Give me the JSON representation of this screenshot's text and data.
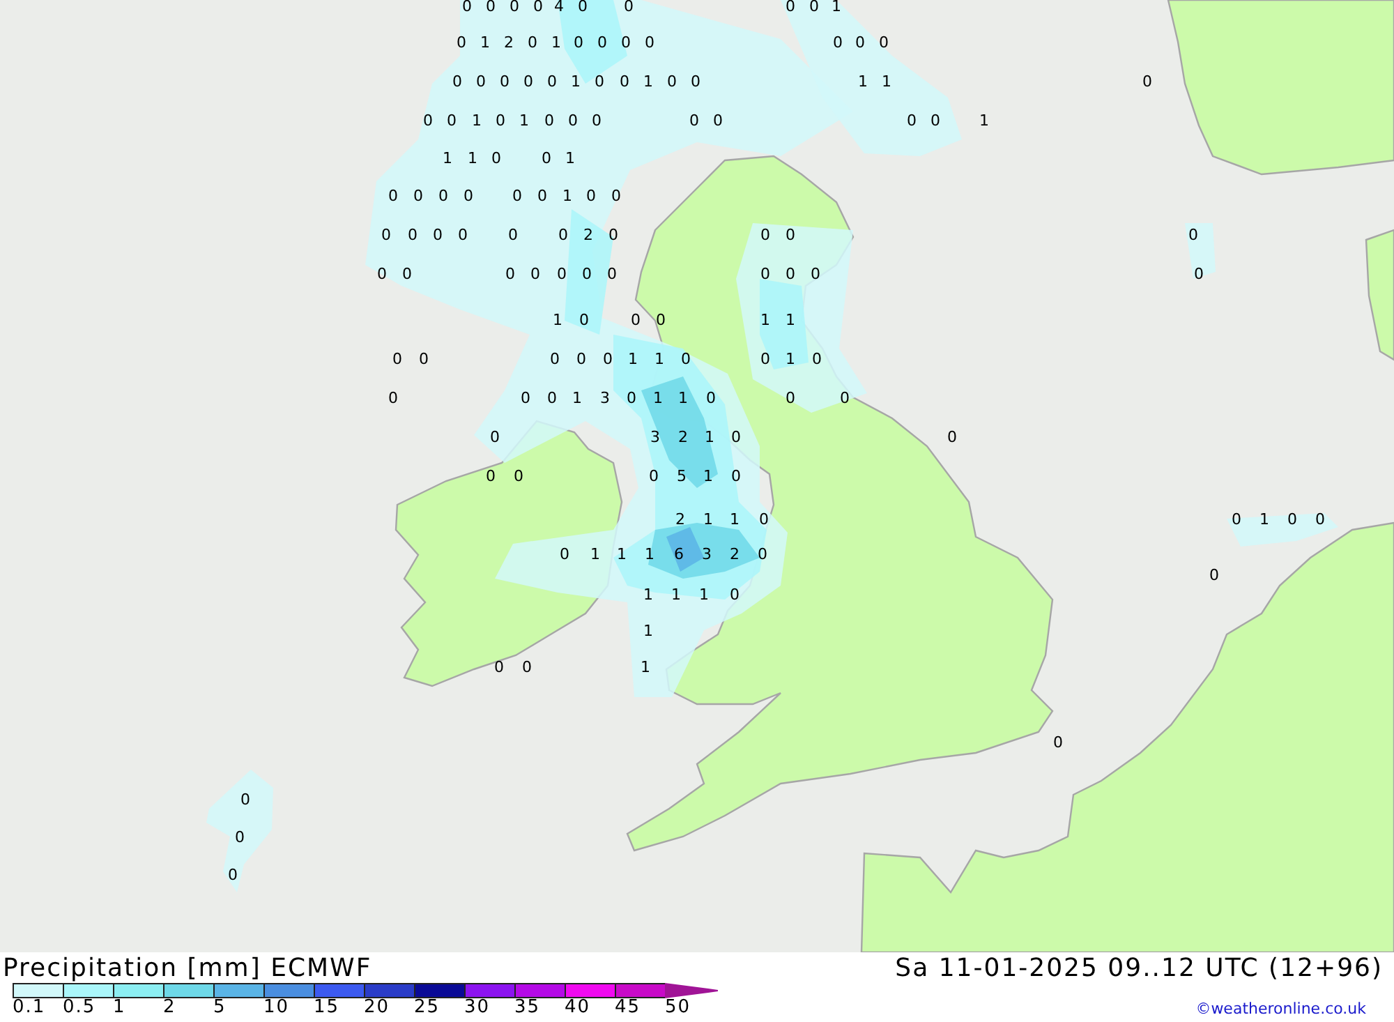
{
  "map_values": [
    "0",
    "0",
    "0",
    "0",
    "4",
    "0",
    "0",
    "0",
    "0",
    "1",
    "0",
    "1",
    "2",
    "0",
    "1",
    "0",
    "0",
    "0",
    "0",
    "0",
    "0",
    "0",
    "0",
    "0",
    "0",
    "0",
    "0",
    "1",
    "0",
    "0",
    "1",
    "0",
    "0",
    "1",
    "1",
    "0",
    "0",
    "0",
    "1",
    "0",
    "1",
    "0",
    "0",
    "0",
    "0",
    "0",
    "0",
    "0",
    "1",
    "1",
    "1",
    "0",
    "0",
    "1",
    "0",
    "0",
    "0",
    "0",
    "0",
    "0",
    "1",
    "0",
    "0",
    "0",
    "0",
    "0",
    "0",
    "0",
    "0",
    "2",
    "0",
    "0",
    "0",
    "0",
    "0",
    "0",
    "0",
    "0",
    "0",
    "0",
    "0",
    "0",
    "0",
    "0",
    "0",
    "1",
    "0",
    "0",
    "0",
    "1",
    "1",
    "0",
    "0",
    "0",
    "0",
    "0",
    "1",
    "1",
    "0",
    "0",
    "1",
    "0",
    "0",
    "0",
    "0",
    "1",
    "3",
    "0",
    "1",
    "1",
    "0",
    "0",
    "0",
    "0",
    "3",
    "2",
    "1",
    "0",
    "0",
    "0",
    "0",
    "0",
    "5",
    "1",
    "0",
    "2",
    "1",
    "1",
    "0",
    "0",
    "1",
    "0",
    "0",
    "0",
    "1",
    "1",
    "1",
    "6",
    "3",
    "2",
    "0",
    "0",
    "1",
    "1",
    "1",
    "0",
    "1",
    "0",
    "0",
    "1",
    "0",
    "0",
    "0",
    "0"
  ],
  "legend": {
    "title": "Precipitation [mm] ECMWF",
    "valid_time": "Sa 11-01-2025 09..12 UTC (12+96)",
    "credit": "©weatheronline.co.uk",
    "scale": [
      {
        "label": "0.1",
        "color": "#d2f8fa"
      },
      {
        "label": "0.5",
        "color": "#aaf6fa"
      },
      {
        "label": "1",
        "color": "#8ceef2"
      },
      {
        "label": "2",
        "color": "#6ed8e8"
      },
      {
        "label": "5",
        "color": "#5ab4e6"
      },
      {
        "label": "10",
        "color": "#4a8ee0"
      },
      {
        "label": "15",
        "color": "#3c5af0"
      },
      {
        "label": "20",
        "color": "#2a3cc8"
      },
      {
        "label": "25",
        "color": "#0a0a96"
      },
      {
        "label": "30",
        "color": "#8c14f0"
      },
      {
        "label": "35",
        "color": "#b40ae6"
      },
      {
        "label": "40",
        "color": "#f00af0"
      },
      {
        "label": "45",
        "color": "#c80ac8"
      },
      {
        "label": "50",
        "color": "#a01496"
      }
    ]
  }
}
